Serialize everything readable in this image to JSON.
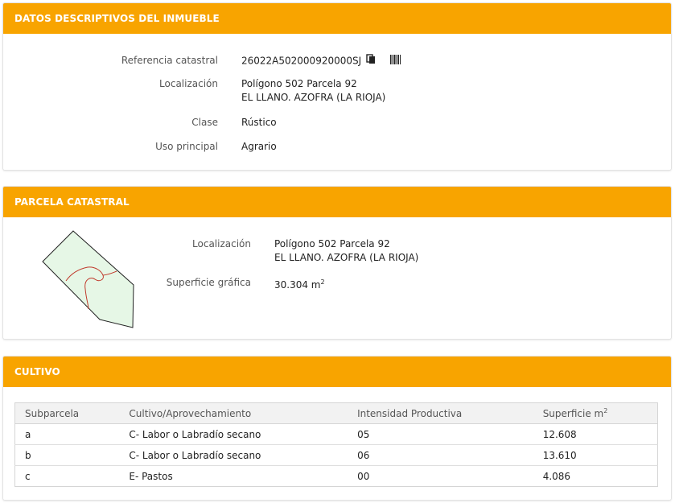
{
  "datos": {
    "title": "DATOS DESCRIPTIVOS DEL INMUEBLE",
    "ref_label": "Referencia catastral",
    "ref_value": "26022A502000920000SJ",
    "loc_label": "Localización",
    "loc_line1": "Polígono 502 Parcela 92",
    "loc_line2": "EL LLANO. AZOFRA (LA RIOJA)",
    "clase_label": "Clase",
    "clase_value": "Rústico",
    "uso_label": "Uso principal",
    "uso_value": "Agrario",
    "icons": [
      "copy-icon",
      "barcode-icon"
    ]
  },
  "parcela": {
    "title": "PARCELA CATASTRAL",
    "loc_label": "Localización",
    "loc_line1": "Polígono 502 Parcela 92",
    "loc_line2": "EL LLANO. AZOFRA (LA RIOJA)",
    "sup_label": "Superficie gráfica",
    "sup_value": "30.304 m",
    "sup_unit_exp": "2"
  },
  "cultivo": {
    "title": "CULTIVO",
    "headers": [
      "Subparcela",
      "Cultivo/Aprovechamiento",
      "Intensidad Productiva",
      "Superficie m"
    ],
    "header_exp": "2",
    "rows": [
      [
        "a",
        "C- Labor o Labradío secano",
        "05",
        "12.608"
      ],
      [
        "b",
        "C- Labor o Labradío secano",
        "06",
        "13.610"
      ],
      [
        "c",
        "E- Pastos",
        "00",
        "4.086"
      ]
    ]
  },
  "colors": {
    "accent": "#f8a400",
    "parcel_fill": "#e6f7e6",
    "subparcel_line": "#c0392b"
  }
}
